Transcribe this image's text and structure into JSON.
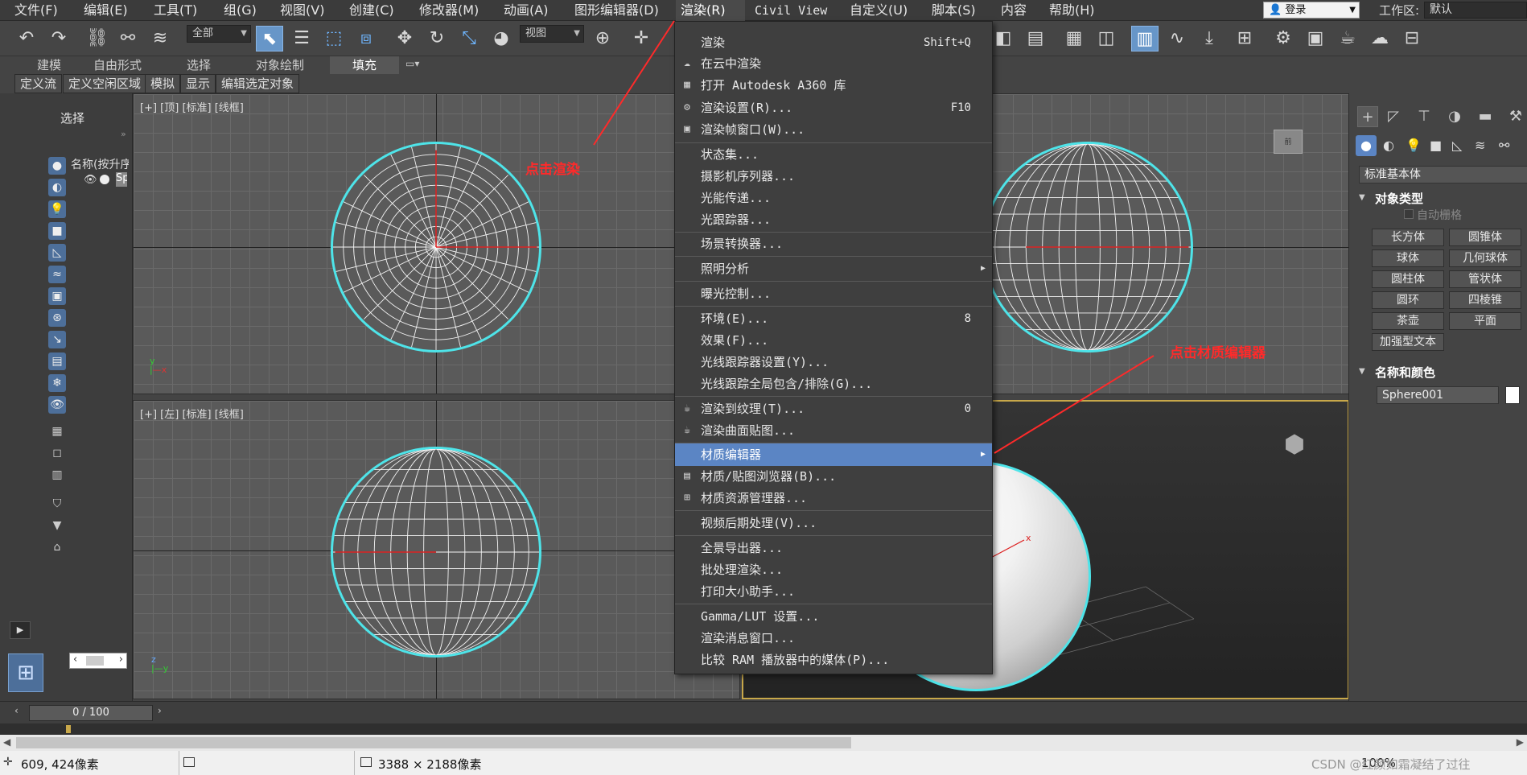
{
  "menubar": {
    "items": [
      "文件(F)",
      "编辑(E)",
      "工具(T)",
      "组(G)",
      "视图(V)",
      "创建(C)",
      "修改器(M)",
      "动画(A)",
      "图形编辑器(D)",
      "渲染(R)",
      "Civil View",
      "自定义(U)",
      "脚本(S)",
      "内容",
      "帮助(H)"
    ],
    "login": "登录",
    "workspace_label": "工作区:",
    "workspace_value": "默认"
  },
  "toolbar": {
    "filter_combo": "全部",
    "view_combo": "视图"
  },
  "ribbon": {
    "tabs": [
      "建模",
      "自由形式",
      "选择",
      "对象绘制",
      "填充"
    ],
    "buttons": [
      "定义流",
      "定义空闲区域",
      "模拟",
      "显示",
      "编辑选定对象"
    ]
  },
  "scene_explorer": {
    "title": "选择",
    "column": "名称(按升序",
    "row": "Sp"
  },
  "viewports": {
    "top_label": "[+] [顶] [标准] [线框]",
    "left_label": "[+] [左] [标准] [线框]"
  },
  "render_menu": {
    "items": [
      {
        "label": "渲染",
        "shortcut": "Shift+Q"
      },
      {
        "label": "在云中渲染",
        "shortcut": ""
      },
      {
        "label": "打开 Autodesk A360 库",
        "shortcut": ""
      },
      {
        "label": "渲染设置(R)...",
        "shortcut": "F10"
      },
      {
        "label": "渲染帧窗口(W)...",
        "shortcut": ""
      },
      {
        "label": "状态集...",
        "shortcut": ""
      },
      {
        "label": "摄影机序列器...",
        "shortcut": ""
      },
      {
        "label": "光能传递...",
        "shortcut": ""
      },
      {
        "label": "光跟踪器...",
        "shortcut": ""
      },
      {
        "label": "场景转换器...",
        "shortcut": ""
      },
      {
        "label": "照明分析",
        "shortcut": ""
      },
      {
        "label": "曝光控制...",
        "shortcut": ""
      },
      {
        "label": "环境(E)...",
        "shortcut": "8"
      },
      {
        "label": "效果(F)...",
        "shortcut": ""
      },
      {
        "label": "光线跟踪器设置(Y)...",
        "shortcut": ""
      },
      {
        "label": "光线跟踪全局包含/排除(G)...",
        "shortcut": ""
      },
      {
        "label": "渲染到纹理(T)...",
        "shortcut": "0"
      },
      {
        "label": "渲染曲面贴图...",
        "shortcut": ""
      },
      {
        "label": "材质编辑器",
        "shortcut": ""
      },
      {
        "label": "材质/贴图浏览器(B)...",
        "shortcut": ""
      },
      {
        "label": "材质资源管理器...",
        "shortcut": ""
      },
      {
        "label": "视频后期处理(V)...",
        "shortcut": ""
      },
      {
        "label": "全景导出器...",
        "shortcut": ""
      },
      {
        "label": "批处理渲染...",
        "shortcut": ""
      },
      {
        "label": "打印大小助手...",
        "shortcut": ""
      },
      {
        "label": "Gamma/LUT 设置...",
        "shortcut": ""
      },
      {
        "label": "渲染消息窗口...",
        "shortcut": ""
      },
      {
        "label": "比较 RAM 播放器中的媒体(P)...",
        "shortcut": ""
      }
    ]
  },
  "annotations": {
    "click_render": "点击渲染",
    "click_material_editor": "点击材质编辑器"
  },
  "command_panel": {
    "category": "标准基本体",
    "object_type_title": "对象类型",
    "autogrid": "自动栅格",
    "buttons": [
      "长方体",
      "圆锥体",
      "球体",
      "几何球体",
      "圆柱体",
      "管状体",
      "圆环",
      "四棱锥",
      "茶壶",
      "平面",
      "加强型文本"
    ],
    "name_color_title": "名称和颜色",
    "object_name": "Sphere001"
  },
  "timeline": {
    "frame": "0 / 100"
  },
  "statusbar": {
    "coords": "609, 424像素",
    "size": "3388 × 2188像素",
    "zoom": "100%",
    "watermark": "CSDN @红颜如霜凝结了过往"
  },
  "colors": {
    "accent": "#5b85c4",
    "selection": "#4ee4e9",
    "annotation": "#ff2a2a"
  }
}
